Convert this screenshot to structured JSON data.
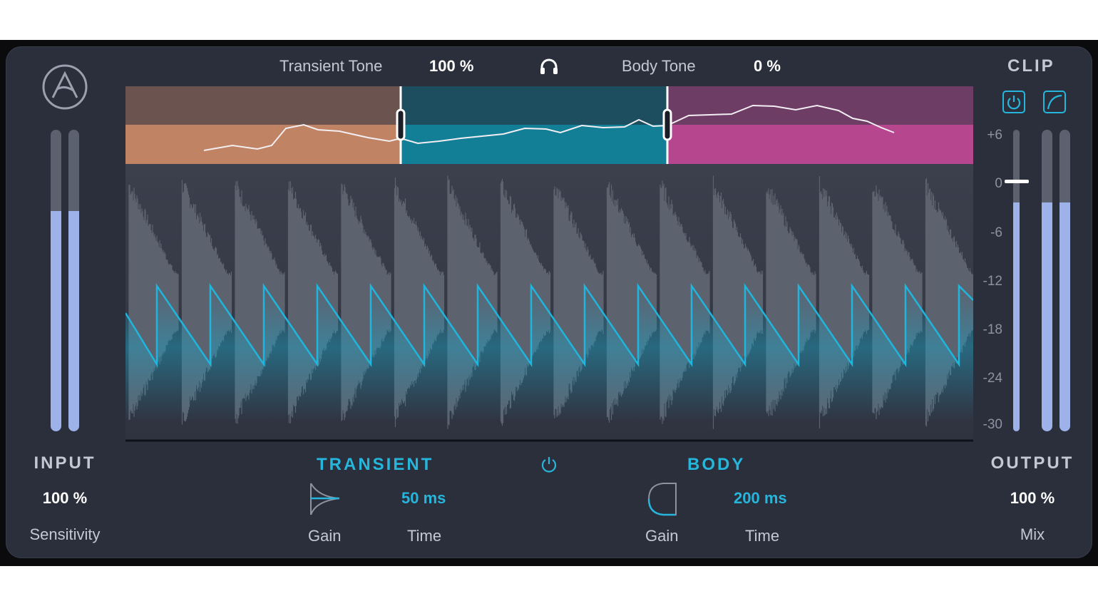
{
  "top_bar": {
    "transient_tone_label": "Transient Tone",
    "transient_tone_value": "100 %",
    "body_tone_label": "Body Tone",
    "body_tone_value": "0 %",
    "listen_icon": "headphones-icon"
  },
  "input": {
    "title": "INPUT",
    "value": "100 %",
    "caption": "Sensitivity",
    "meter_levels": [
      0.73,
      0.73
    ]
  },
  "clip": {
    "title": "CLIP",
    "power_icon": "power-icon",
    "curve_icon": "curve-icon"
  },
  "output": {
    "title": "OUTPUT",
    "value": "100 %",
    "caption": "Mix",
    "meter_levels": [
      0.76,
      0.76
    ],
    "fader_level_db": 0
  },
  "scale": {
    "ticks": [
      "+6",
      "0",
      "-6",
      "-12",
      "-18",
      "-24",
      "-30"
    ]
  },
  "transient": {
    "title": "TRANSIENT",
    "gain_caption": "Gain",
    "time_value": "50 ms",
    "time_caption": "Time"
  },
  "body": {
    "title": "BODY",
    "gain_caption": "Gain",
    "time_value": "200 ms",
    "time_caption": "Time"
  },
  "colors": {
    "accent": "#26b6dc",
    "band_low": "#c08363",
    "band_mid": "#127f96",
    "band_high": "#b6478f",
    "meter": "#9cb2e8",
    "panel": "#2b2f3c"
  }
}
